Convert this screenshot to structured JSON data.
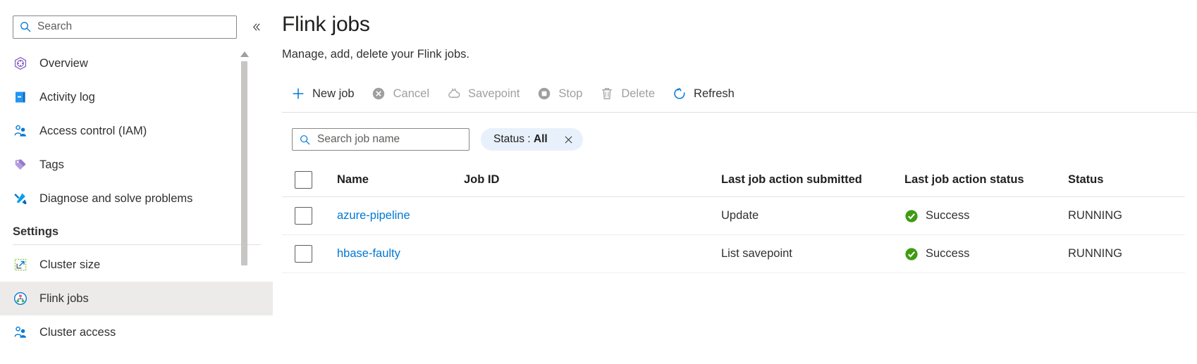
{
  "sidebar": {
    "search": {
      "placeholder": "Search",
      "value": "",
      "icon": "search-icon"
    },
    "collapse_icon": "chevron-double-left-icon",
    "items": [
      {
        "label": "Overview",
        "icon": "overview-icon",
        "selected": false
      },
      {
        "label": "Activity log",
        "icon": "activity-log-icon",
        "selected": false
      },
      {
        "label": "Access control (IAM)",
        "icon": "people-icon",
        "selected": false
      },
      {
        "label": "Tags",
        "icon": "tag-icon",
        "selected": false
      },
      {
        "label": "Diagnose and solve problems",
        "icon": "wrench-icon",
        "selected": false
      }
    ],
    "section_title": "Settings",
    "settings_items": [
      {
        "label": "Cluster size",
        "icon": "resize-icon",
        "selected": false
      },
      {
        "label": "Flink jobs",
        "icon": "flink-jobs-icon",
        "selected": true
      },
      {
        "label": "Cluster access",
        "icon": "people-icon",
        "selected": false
      }
    ]
  },
  "main": {
    "title": "Flink jobs",
    "subtitle": "Manage, add, delete your Flink jobs.",
    "toolbar": [
      {
        "label": "New job",
        "icon": "plus-icon",
        "disabled": false
      },
      {
        "label": "Cancel",
        "icon": "cancel-icon",
        "disabled": true
      },
      {
        "label": "Savepoint",
        "icon": "cloud-icon",
        "disabled": true
      },
      {
        "label": "Stop",
        "icon": "stop-icon",
        "disabled": true
      },
      {
        "label": "Delete",
        "icon": "trash-icon",
        "disabled": true
      },
      {
        "label": "Refresh",
        "icon": "refresh-icon",
        "disabled": false
      }
    ],
    "job_search": {
      "placeholder": "Search job name",
      "value": "",
      "icon": "search-icon"
    },
    "filter_pill": {
      "key": "Status :",
      "value": "All",
      "close_icon": "close-icon"
    },
    "table": {
      "columns": [
        "Name",
        "Job ID",
        "Last job action submitted",
        "Last job action status",
        "Status"
      ],
      "rows": [
        {
          "name": "azure-pipeline",
          "job_id": "",
          "last_action": "Update",
          "last_action_status": "Success",
          "last_action_status_icon": "success-check-icon",
          "status": "RUNNING"
        },
        {
          "name": "hbase-faulty",
          "job_id": "",
          "last_action": "List savepoint",
          "last_action_status": "Success",
          "last_action_status_icon": "success-check-icon",
          "status": "RUNNING"
        }
      ]
    }
  },
  "colors": {
    "accent_blue": "#0078d4",
    "link_blue": "#1a8cf0",
    "success_green": "#3f9c12",
    "pill_bg": "#e8f1fb",
    "selected_bg": "#edebe9",
    "disabled_gray": "#a19f9d"
  }
}
